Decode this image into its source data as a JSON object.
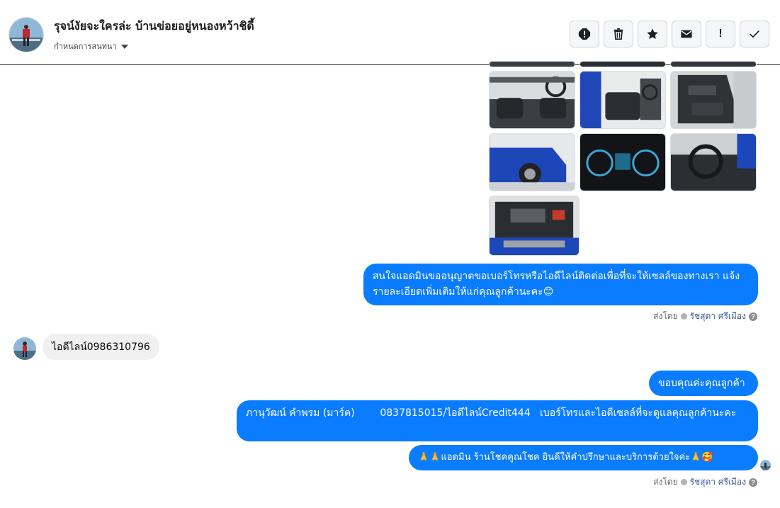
{
  "header": {
    "title": "รุจน์งัยจะใครล่ะ บ้านข่อยอยู่หนองหว้าชิดี้",
    "subtitle": "กำหนดการสนทนา",
    "actions": [
      {
        "name": "report-icon",
        "glyph": ""
      },
      {
        "name": "trash-icon",
        "glyph": ""
      },
      {
        "name": "star-icon",
        "glyph": ""
      },
      {
        "name": "mail-icon",
        "glyph": ""
      },
      {
        "name": "exclamation-icon",
        "glyph": "!"
      },
      {
        "name": "check-icon",
        "glyph": ""
      }
    ]
  },
  "messages": {
    "out_1": "สนใจแอดมินขออนุญาตขอเบอร์โทรหรือไอดีไลน์ติดต่อเพื่อที่จะให้เซลล์ของทางเรา แจ้งรายละเอียดเพิ่มเติมให้แก่คุณลูกค้านะคะ😊",
    "in_1": "ไอดีไลน์0986310796",
    "out_2": "ขอบคุณค่ะคุณลูกค้า",
    "out_3": "ภานุวัฒน์ คำพรม (มาร์ค)        0837815015/ไอดีไลน์Credit444   เบอร์โทรและไอดีเซลล์ที่จะดูแลคุณลูกค้านะคะ",
    "out_4": "🙏🙏แอดมิน ร้านโชคคูณโชค ยินดีให้คำปรึกษาและบริการด้วยใจค่ะ🙏🥰"
  },
  "sent_by": {
    "prefix": "ส่งโดย",
    "agent": "รัชสุดา ศรีเมือง",
    "help": "?"
  },
  "colors": {
    "outgoing_bubble": "#0a7cff",
    "incoming_bubble": "#f0f0f0",
    "link": "#385898"
  }
}
